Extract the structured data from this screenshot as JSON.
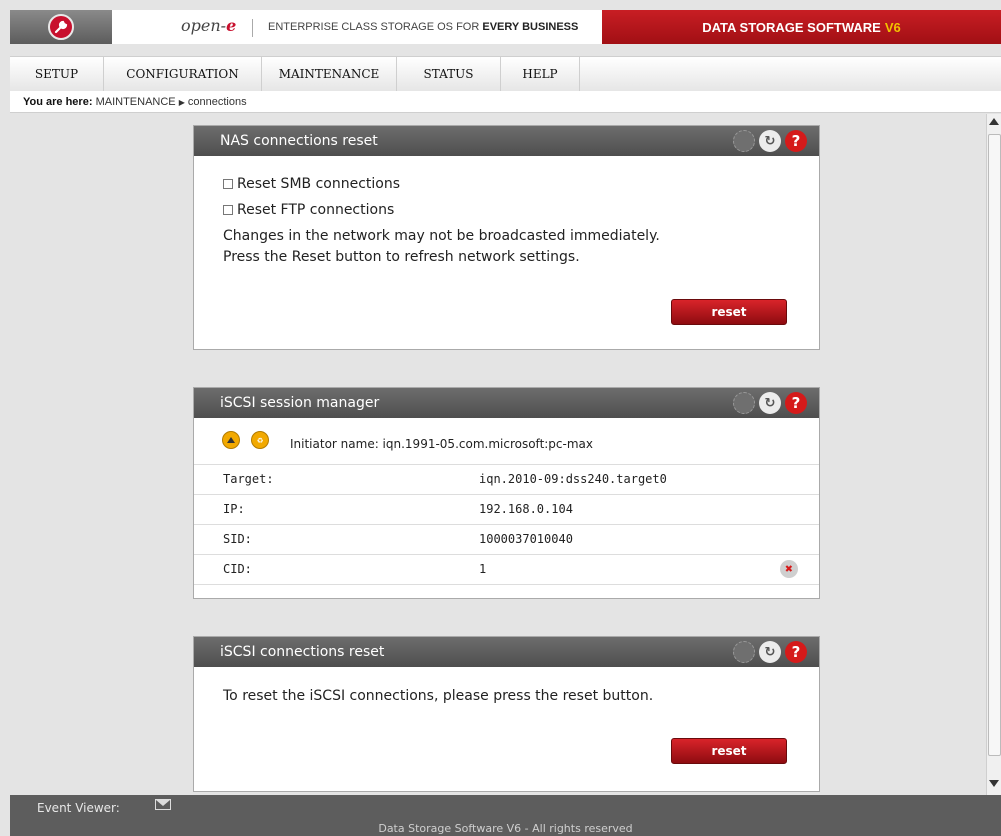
{
  "header": {
    "brand_name": "open-",
    "brand_e": "e",
    "tagline_prefix": "ENTERPRISE CLASS STORAGE OS for ",
    "tagline_bold": "EVERY BUSINESS",
    "product": "DATA STORAGE SOFTWARE",
    "product_version": "V6"
  },
  "nav": {
    "items": [
      {
        "label": "SETUP"
      },
      {
        "label": "CONFIGURATION"
      },
      {
        "label": "MAINTENANCE"
      },
      {
        "label": "STATUS"
      },
      {
        "label": "HELP"
      }
    ]
  },
  "breadcrumb": {
    "prefix": "You are here:",
    "section": "MAINTENANCE",
    "separator": "▶",
    "page": "connections"
  },
  "nas_reset": {
    "title": "NAS connections reset",
    "smb_label": "Reset SMB connections",
    "smb_checked": false,
    "ftp_label": "Reset FTP connections",
    "ftp_checked": false,
    "info_line1": "Changes in the network may not be broadcasted immediately.",
    "info_line2": "Press the Reset button to refresh network settings.",
    "button": "reset"
  },
  "session_manager": {
    "title": "iSCSI session manager",
    "initiator": "Initiator name: iqn.1991-05.com.microsoft:pc-max",
    "rows": [
      {
        "label": "Target:",
        "value": "iqn.2010-09:dss240.target0"
      },
      {
        "label": "IP:",
        "value": "192.168.0.104"
      },
      {
        "label": "SID:",
        "value": "1000037010040"
      },
      {
        "label": "CID:",
        "value": "1"
      }
    ]
  },
  "iscsi_reset": {
    "title": "iSCSI connections reset",
    "text": "To reset the iSCSI connections, please press the reset button.",
    "button": "reset"
  },
  "footer": {
    "event_viewer": "Event Viewer:",
    "copyright": "Data Storage Software V6 - All rights reserved"
  },
  "icons": {
    "logo": "wrench-icon",
    "panel_disabled": "loading-icon",
    "panel_refresh": "refresh-icon",
    "panel_help": "help-icon",
    "delete": "delete-icon",
    "envelope": "envelope-icon"
  },
  "colors": {
    "accent_red": "#c8102e",
    "version_yellow": "#f2c200",
    "panel_header": "#5a5a5a"
  }
}
